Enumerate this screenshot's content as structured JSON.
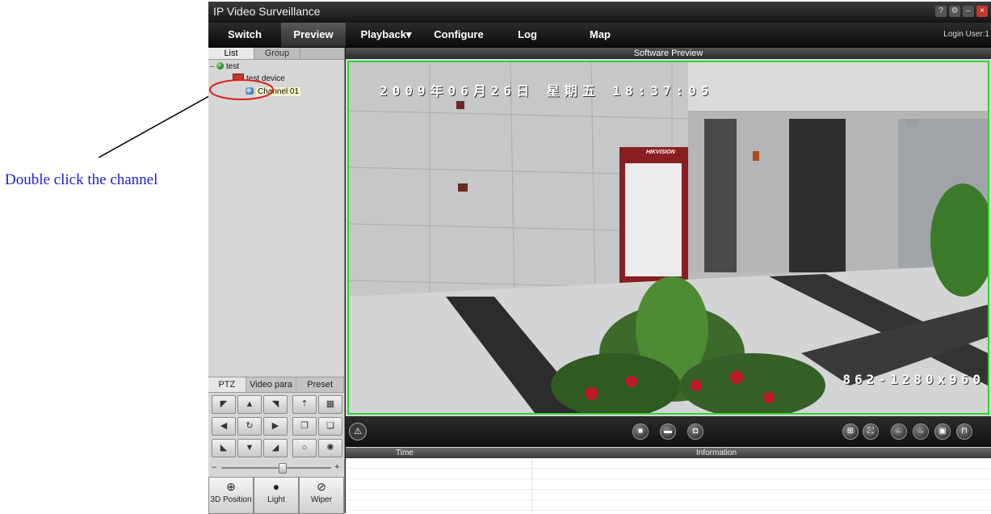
{
  "annotation": {
    "text": "Double click the channel"
  },
  "window": {
    "title": "IP Video Surveillance",
    "buttons": [
      {
        "icon": "help-icon",
        "glyph": "?"
      },
      {
        "icon": "settings-icon",
        "glyph": "⚙"
      },
      {
        "icon": "minimize-icon",
        "glyph": "–"
      },
      {
        "icon": "close-icon",
        "glyph": "×"
      }
    ]
  },
  "menu": {
    "items": [
      "Switch",
      "Preview",
      "Playback▾",
      "Configure",
      "Log",
      "Map"
    ],
    "active": "Preview",
    "login": "Login User:1"
  },
  "left_panel": {
    "tabs": [
      "List",
      "Group"
    ],
    "tree": {
      "root": "test",
      "device": "test device",
      "channel": "Channel 01"
    },
    "ptz_tabs": [
      "PTZ",
      "Video para",
      "Preset"
    ],
    "ptz_buttons": [
      {
        "name": "ptz-up-left-button",
        "glyph": "◤"
      },
      {
        "name": "ptz-up-button",
        "glyph": "▲"
      },
      {
        "name": "ptz-up-right-button",
        "glyph": "◥"
      },
      {
        "name": "zoom-in-button",
        "glyph": "⇡"
      },
      {
        "name": "grid-button",
        "glyph": "▦"
      },
      {
        "name": "ptz-left-button",
        "glyph": "◀"
      },
      {
        "name": "ptz-auto-button",
        "glyph": "↻"
      },
      {
        "name": "ptz-right-button",
        "glyph": "▶"
      },
      {
        "name": "focus-near-button",
        "glyph": "❐"
      },
      {
        "name": "focus-far-button",
        "glyph": "❏"
      },
      {
        "name": "ptz-down-left-button",
        "glyph": "◣"
      },
      {
        "name": "ptz-down-button",
        "glyph": "▼"
      },
      {
        "name": "ptz-down-right-button",
        "glyph": "◢"
      },
      {
        "name": "iris-close-button",
        "glyph": "○"
      },
      {
        "name": "iris-open-button",
        "glyph": "✺"
      }
    ],
    "speed_level": 0.55,
    "actions": [
      {
        "label": "3D Position",
        "icon": "magnifier-icon",
        "glyph": "⊕"
      },
      {
        "label": "Light",
        "icon": "light-icon",
        "glyph": "💡"
      },
      {
        "label": "Wiper",
        "icon": "wiper-icon",
        "glyph": "⊘"
      }
    ]
  },
  "preview": {
    "title": "Software Preview",
    "osd_date": "2009年06月26日 星期五 18:37:05",
    "osd_resolution": "862-1280x960",
    "sign_brand": "HIKVISION",
    "accent_color": "#2fd52f"
  },
  "controls": {
    "alert_icon": "warning-icon",
    "center": [
      {
        "icon": "stop-icon",
        "glyph": "■"
      },
      {
        "icon": "record-icon",
        "glyph": "▬"
      },
      {
        "icon": "snapshot-icon",
        "glyph": "◘"
      }
    ],
    "right": [
      {
        "icon": "split-screen-icon",
        "glyph": "⊞"
      },
      {
        "icon": "fullscreen-icon",
        "glyph": "⛶"
      },
      {
        "icon": "previous-icon",
        "glyph": "←"
      },
      {
        "icon": "next-icon",
        "glyph": "→"
      },
      {
        "icon": "save-icon",
        "glyph": "▣"
      },
      {
        "icon": "exit-icon",
        "glyph": "⊓"
      }
    ]
  },
  "log": {
    "columns": [
      "Time",
      "Information"
    ]
  }
}
